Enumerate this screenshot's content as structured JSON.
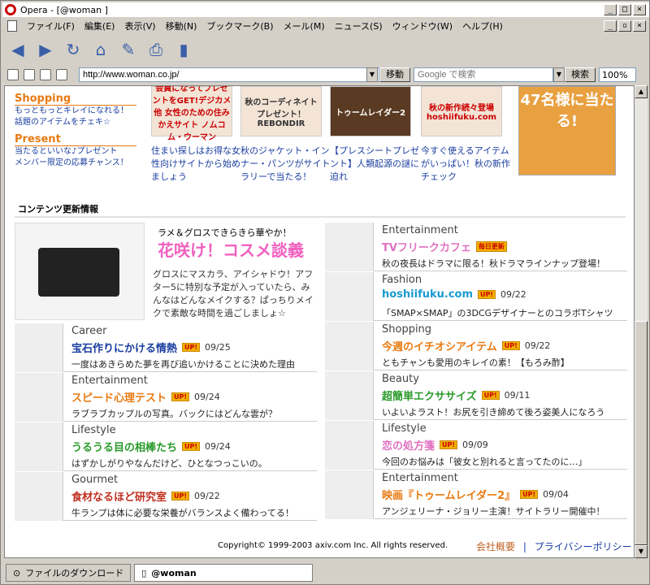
{
  "window": {
    "title": "Opera - [@woman ]"
  },
  "menu": [
    "ファイル(F)",
    "編集(E)",
    "表示(V)",
    "移動(N)",
    "ブックマーク(B)",
    "メール(M)",
    "ニュース(S)",
    "ウィンドウ(W)",
    "ヘルプ(H)"
  ],
  "address": {
    "url": "http://www.woman.co.jp/",
    "go_label": "移動",
    "search_placeholder": "Google で検索",
    "search_label": "検索",
    "zoom": "100%"
  },
  "promo": {
    "shopping_h": "Shopping",
    "shopping_l1": "もっともっとキレイになれる！",
    "shopping_l2": "話題のアイテムをチェキ☆",
    "present_h": "Present",
    "present_l1": "当たるといいな♪プレゼント",
    "present_l2": "メンバー限定の応募チャンス！",
    "banners": [
      {
        "img": "会員になってプレゼントをGET!デジカメ他 女性のための住みかえサイト ノムコム・ウーマン",
        "caption": "住まい探しはお得な女性向けサイトから始めましょう"
      },
      {
        "img": "秋のコーディネイトプレゼント！ REBONDIR",
        "caption": "秋のジャケット・インナー・パンツがサイトラリーで当たる！"
      },
      {
        "img": "トゥームレイダー2",
        "caption": "【プレスシートプレゼント】人類起源の謎に迫れ"
      },
      {
        "img": "秋の新作続々登場 hoshiifuku.com",
        "caption": "今すぐ使えるアイテムがいっぱい！秋の新作チェック"
      }
    ],
    "big_banner": "47名様に当たる!"
  },
  "section_title": "コンテンツ更新情報",
  "feature": {
    "kicker": "ラメ＆グロスできらきら華やか！",
    "title": "花咲け！コスメ談義",
    "body": "グロスにマスカラ、アイシャドウ！アフター5に特別な予定が入っていたら、みんなはどんなメイクする？ぱっちりメイクで素敵な時間を過ごしましょ☆"
  },
  "left_items": [
    {
      "cat": "Career",
      "title": "宝石作りにかける情熱",
      "color": "#1a3ea0",
      "badge": "UP!",
      "date": "09/25",
      "desc": "一度はあきらめた夢を再び追いかけることに決めた理由"
    },
    {
      "cat": "Entertainment",
      "title": "スピード心理テスト",
      "color": "#e87a12",
      "badge": "UP!",
      "date": "09/24",
      "desc": "ラブラブカップルの写真。バックにはどんな雲が？"
    },
    {
      "cat": "Lifestyle",
      "title": "うるうる目の相棒たち",
      "color": "#2a9a2a",
      "badge": "UP!",
      "date": "09/24",
      "desc": "はずかしがりやなんだけど、ひとなつっこいの。"
    },
    {
      "cat": "Gourmet",
      "title": "食材なるほど研究室",
      "color": "#c03020",
      "badge": "UP!",
      "date": "09/22",
      "desc": "牛ランプは体に必要な栄養がバランスよく備わってる！"
    }
  ],
  "right_items": [
    {
      "cat": "Entertainment",
      "title": "TVフリークカフェ",
      "color": "#e070c0",
      "badge": "毎日更新",
      "date": "",
      "desc": "秋の夜長はドラマに限る！秋ドラマラインナップ登場！"
    },
    {
      "cat": "Fashion",
      "title": "hoshiifuku.com",
      "color": "#1a9ad0",
      "badge": "UP!",
      "date": "09/22",
      "desc": "「SMAP×SMAP」の3DCGデザイナーとのコラボTシャツ"
    },
    {
      "cat": "Shopping",
      "title": "今週のイチオシアイテム",
      "color": "#e87a12",
      "badge": "UP!",
      "date": "09/22",
      "desc": "ともチャンも愛用のキレイの素！【もろみ酢】"
    },
    {
      "cat": "Beauty",
      "title": "超簡単エクササイズ",
      "color": "#2a9a2a",
      "badge": "UP!",
      "date": "09/11",
      "desc": "いよいよラスト！お尻を引き締めて後ろ姿美人になろう"
    },
    {
      "cat": "Lifestyle",
      "title": "恋の処方箋",
      "color": "#e070c0",
      "badge": "UP!",
      "date": "09/09",
      "desc": "今回のお悩みは「彼女と別れると言ってたのに…」"
    },
    {
      "cat": "Entertainment",
      "title": "映画『トゥームレイダー2』",
      "color": "#e87a12",
      "badge": "UP!",
      "date": "09/04",
      "desc": "アンジェリーナ・ジョリー主演！サイトラリー開催中！"
    }
  ],
  "footer": {
    "copyright": "Copyright© 1999-2003 axiv.com Inc. All rights reserved.",
    "link1": "会社概要",
    "sep": "|",
    "link2": "プライバシーポリシー"
  },
  "status": {
    "download_tab": "ファイルのダウンロード",
    "page_tab": "@woman"
  }
}
